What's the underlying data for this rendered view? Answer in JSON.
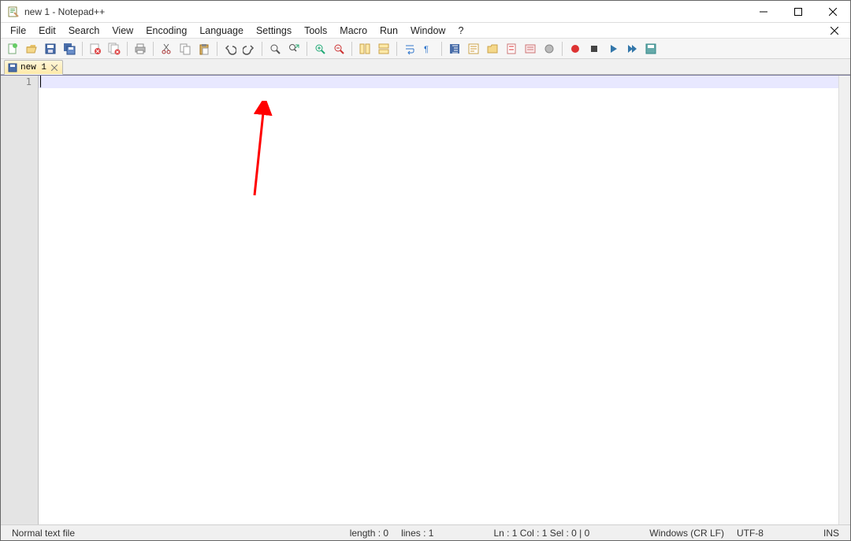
{
  "window": {
    "title": "new 1 - Notepad++"
  },
  "menus": [
    "File",
    "Edit",
    "Search",
    "View",
    "Encoding",
    "Language",
    "Settings",
    "Tools",
    "Macro",
    "Run",
    "Window",
    "?"
  ],
  "toolbar_icons": [
    "new-file",
    "open-file",
    "save",
    "save-all",
    "|",
    "close",
    "close-all",
    "|",
    "print",
    "|",
    "cut",
    "copy",
    "paste",
    "|",
    "undo",
    "redo",
    "|",
    "find",
    "replace",
    "|",
    "zoom-in",
    "zoom-out",
    "|",
    "sync-v",
    "sync-h",
    "|",
    "word-wrap",
    "show-all-chars",
    "|",
    "indent-guide",
    "user-lang",
    "folder-as-workspace",
    "doc-map",
    "doc-list",
    "function-list",
    "|",
    "macro-record",
    "macro-stop",
    "macro-play",
    "macro-play-multi",
    "macro-save"
  ],
  "tab": {
    "label": "new 1"
  },
  "editor": {
    "line_numbers": [
      "1"
    ]
  },
  "status": {
    "filetype": "Normal text file",
    "length": "length : 0",
    "lines": "lines : 1",
    "pos": "Ln : 1    Col : 1    Sel : 0 | 0",
    "eol": "Windows (CR LF)",
    "encoding": "UTF-8",
    "ovr": "INS"
  }
}
